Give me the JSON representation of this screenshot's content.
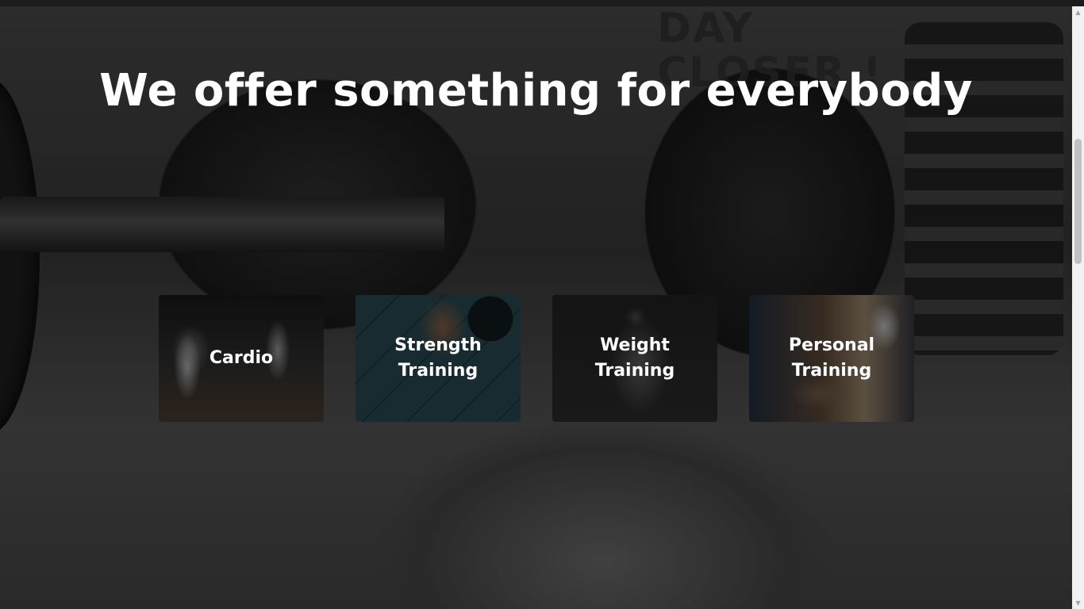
{
  "section": {
    "headline": "We offer something for everybody"
  },
  "services": [
    {
      "label": "Cardio"
    },
    {
      "label": "Strength Training"
    },
    {
      "label": "Weight Training"
    },
    {
      "label": "Personal Training"
    }
  ],
  "background": {
    "wall_text": "DAY\nCLOSER !"
  },
  "colors": {
    "text": "#ffffff",
    "overlay": "#000000"
  }
}
